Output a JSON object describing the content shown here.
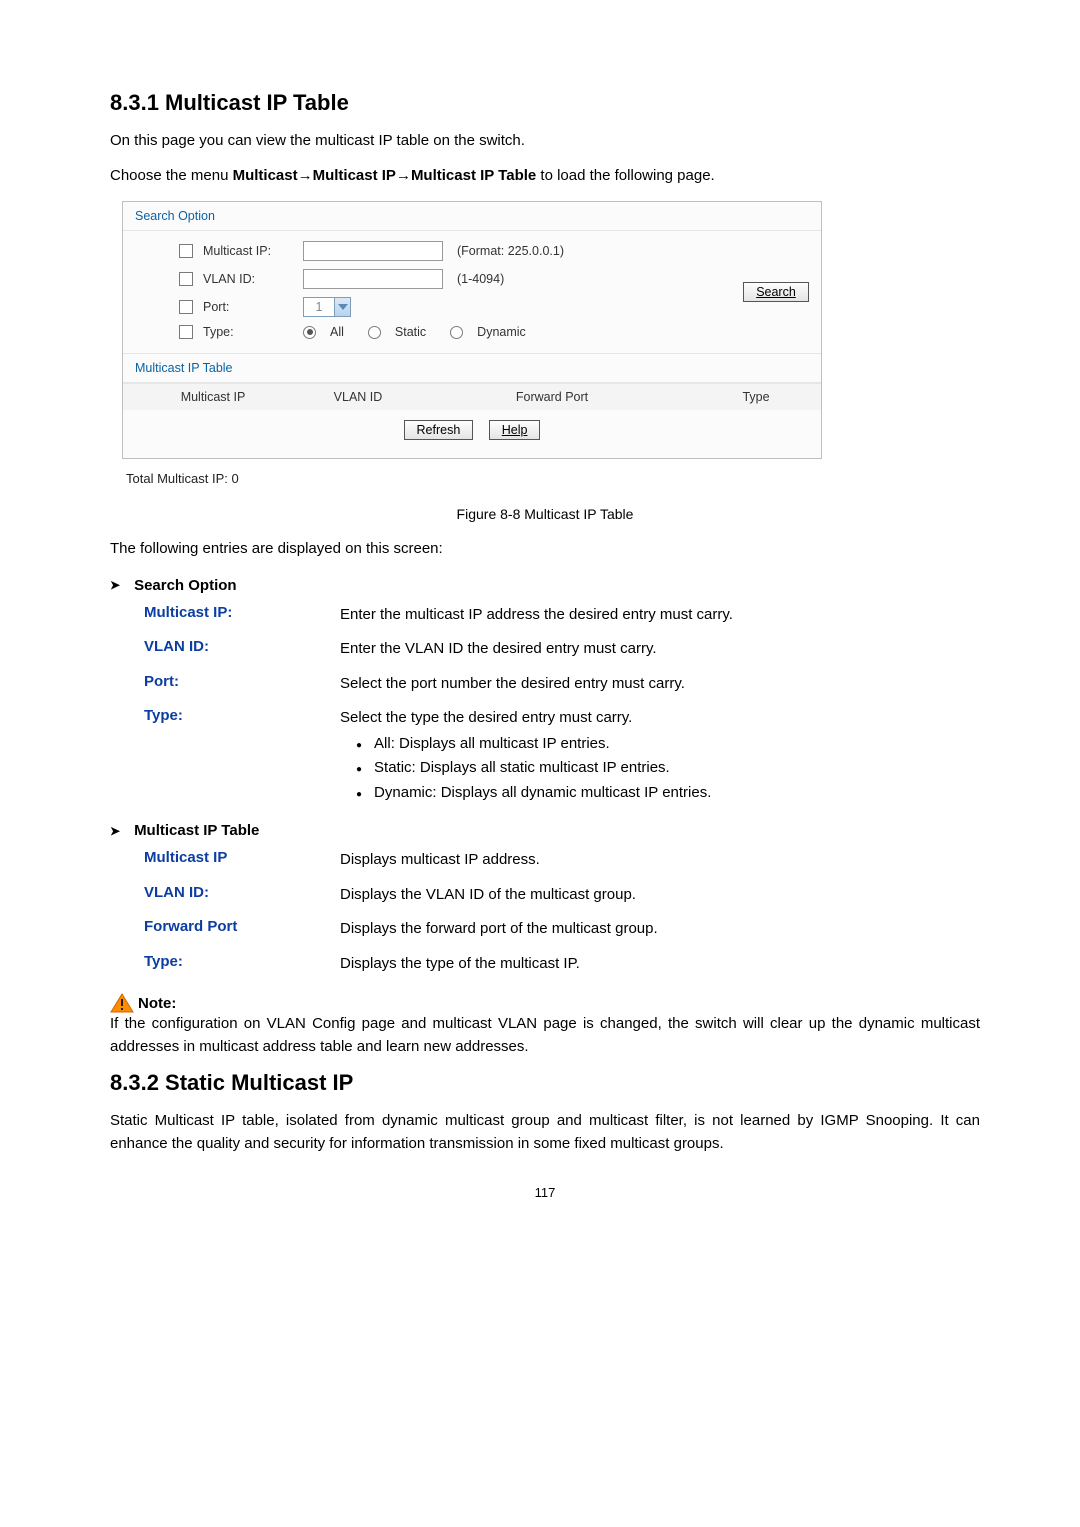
{
  "section1": {
    "number_title": "8.3.1 Multicast IP Table",
    "intro": "On this page you can view the multicast IP table on the switch.",
    "menu_pre": "Choose the menu ",
    "menu_bold": "Multicast→Multicast IP→Multicast IP Table",
    "menu_post": " to load the following page."
  },
  "panel": {
    "search_option": "Search Option",
    "labels": {
      "mcast_ip": "Multicast IP:",
      "vlan_id": "VLAN ID:",
      "port": "Port:",
      "type": "Type:"
    },
    "suffix_mcast": "(Format: 225.0.0.1)",
    "suffix_vlan": "(1-4094)",
    "port_value": "1",
    "type_all": "All",
    "type_static": "Static",
    "type_dynamic": "Dynamic",
    "search_btn": "Search",
    "table_title": "Multicast IP Table",
    "th_mcast": "Multicast IP",
    "th_vlan": "VLAN ID",
    "th_fwd": "Forward Port",
    "th_type": "Type",
    "refresh_btn": "Refresh",
    "help_btn": "Help",
    "total": "Total Multicast IP: 0"
  },
  "figure_caption": "Figure 8-8 Multicast IP Table",
  "entries_intro": "The following entries are displayed on this screen:",
  "search_option_head": "Search Option",
  "defs1": {
    "mcast_ip": {
      "term": "Multicast IP:",
      "def": "Enter the multicast IP address the desired entry must carry."
    },
    "vlan_id": {
      "term": "VLAN ID:",
      "def": "Enter the VLAN ID the desired entry must carry."
    },
    "port": {
      "term": "Port:",
      "def": "Select the port number the desired entry must carry."
    },
    "type": {
      "term": "Type:",
      "def": "Select the type the desired entry must carry.",
      "b1": "All: Displays all multicast IP entries.",
      "b2": "Static: Displays all static multicast IP entries.",
      "b3": "Dynamic: Displays all dynamic multicast IP entries."
    }
  },
  "table_head": "Multicast IP Table",
  "defs2": {
    "mcast_ip": {
      "term": "Multicast IP",
      "def": "Displays multicast IP address."
    },
    "vlan_id": {
      "term": "VLAN ID:",
      "def": "Displays the VLAN ID of the multicast group."
    },
    "fwd": {
      "term": "Forward Port",
      "def": "Displays the forward port of the multicast group."
    },
    "type": {
      "term": "Type:",
      "def": "Displays the type of the multicast IP."
    }
  },
  "note_label": "Note:",
  "note_body": "If the configuration on VLAN Config page and multicast VLAN page is changed, the switch will clear up the dynamic multicast addresses in multicast address table and learn new addresses.",
  "section2": {
    "number_title": "8.3.2 Static Multicast IP",
    "body": "Static Multicast IP table, isolated from dynamic multicast group and multicast filter, is not learned by IGMP Snooping. It can enhance the quality and security for information transmission in some fixed multicast groups."
  },
  "page_number": "117"
}
